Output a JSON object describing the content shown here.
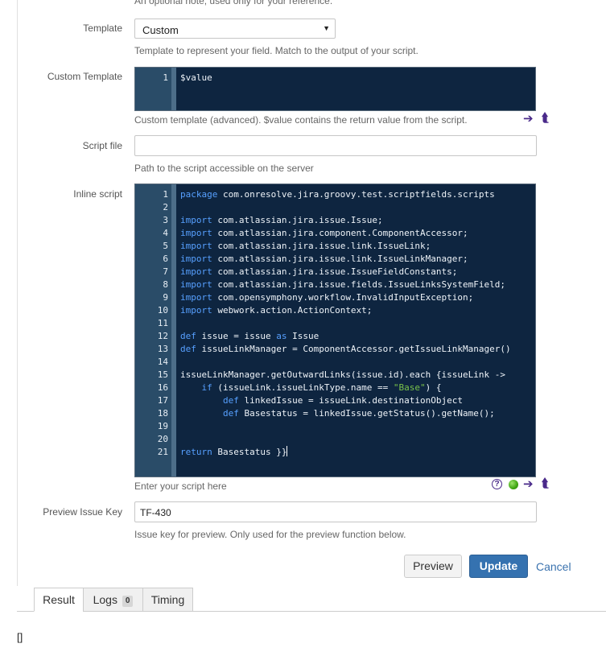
{
  "top_help": "An optional note, used only for your reference.",
  "template": {
    "label": "Template",
    "value": "Custom",
    "help": "Template to represent your field. Match to the output of your script."
  },
  "custom_template": {
    "label": "Custom Template",
    "lines": [
      {
        "n": "1",
        "text": "$value"
      }
    ],
    "help": "Custom template (advanced). $value contains the return value from the script."
  },
  "script_file": {
    "label": "Script file",
    "value": "",
    "help": "Path to the script accessible on the server"
  },
  "inline_script": {
    "label": "Inline script",
    "help": "Enter your script here",
    "lines": [
      {
        "n": "1",
        "parts": [
          {
            "t": "package",
            "c": "kw"
          },
          {
            "t": " com.onresolve.jira.groovy.test.scriptfields.scripts"
          }
        ]
      },
      {
        "n": "2",
        "parts": []
      },
      {
        "n": "3",
        "parts": [
          {
            "t": "import",
            "c": "kw"
          },
          {
            "t": " com.atlassian.jira.issue.Issue;"
          }
        ]
      },
      {
        "n": "4",
        "parts": [
          {
            "t": "import",
            "c": "kw"
          },
          {
            "t": " com.atlassian.jira.component.ComponentAccessor;"
          }
        ]
      },
      {
        "n": "5",
        "parts": [
          {
            "t": "import",
            "c": "kw"
          },
          {
            "t": " com.atlassian.jira.issue.link.IssueLink;"
          }
        ]
      },
      {
        "n": "6",
        "parts": [
          {
            "t": "import",
            "c": "kw"
          },
          {
            "t": " com.atlassian.jira.issue.link.IssueLinkManager;"
          }
        ]
      },
      {
        "n": "7",
        "parts": [
          {
            "t": "import",
            "c": "kw"
          },
          {
            "t": " com.atlassian.jira.issue.IssueFieldConstants;"
          }
        ]
      },
      {
        "n": "8",
        "parts": [
          {
            "t": "import",
            "c": "kw"
          },
          {
            "t": " com.atlassian.jira.issue.fields.IssueLinksSystemField;"
          }
        ]
      },
      {
        "n": "9",
        "parts": [
          {
            "t": "import",
            "c": "kw"
          },
          {
            "t": " com.opensymphony.workflow.InvalidInputException;"
          }
        ]
      },
      {
        "n": "10",
        "parts": [
          {
            "t": "import",
            "c": "kw"
          },
          {
            "t": " webwork.action.ActionContext;"
          }
        ]
      },
      {
        "n": "11",
        "parts": []
      },
      {
        "n": "12",
        "parts": [
          {
            "t": "def",
            "c": "kw"
          },
          {
            "t": " issue = issue "
          },
          {
            "t": "as",
            "c": "kw"
          },
          {
            "t": " Issue"
          }
        ]
      },
      {
        "n": "13",
        "parts": [
          {
            "t": "def",
            "c": "kw"
          },
          {
            "t": " issueLinkManager = ComponentAccessor.getIssueLinkManager()"
          }
        ]
      },
      {
        "n": "14",
        "parts": []
      },
      {
        "n": "15",
        "parts": [
          {
            "t": "issueLinkManager.getOutwardLinks(issue.id).each {issueLink ->"
          }
        ]
      },
      {
        "n": "16",
        "parts": [
          {
            "t": "    "
          },
          {
            "t": "if",
            "c": "kw"
          },
          {
            "t": " (issueLink.issueLinkType.name == "
          },
          {
            "t": "\"Base\"",
            "c": "str"
          },
          {
            "t": ") {"
          }
        ]
      },
      {
        "n": "17",
        "parts": [
          {
            "t": "        "
          },
          {
            "t": "def",
            "c": "kw"
          },
          {
            "t": " linkedIssue = issueLink.destinationObject"
          }
        ]
      },
      {
        "n": "18",
        "parts": [
          {
            "t": "        "
          },
          {
            "t": "def",
            "c": "kw"
          },
          {
            "t": " Basestatus = linkedIssue.getStatus().getName();"
          }
        ]
      },
      {
        "n": "19",
        "parts": []
      },
      {
        "n": "20",
        "parts": []
      },
      {
        "n": "21",
        "parts": [
          {
            "t": "return",
            "c": "kw"
          },
          {
            "t": " Basestatus }}"
          }
        ],
        "cursor": true
      }
    ]
  },
  "preview_issue_key": {
    "label": "Preview Issue Key",
    "value": "TF-430",
    "help": "Issue key for preview. Only used for the preview function below."
  },
  "buttons": {
    "preview": "Preview",
    "update": "Update",
    "cancel": "Cancel"
  },
  "tabs": {
    "result": "Result",
    "logs": "Logs",
    "logs_count": "0",
    "timing": "Timing"
  },
  "result_text": "[]",
  "icons": {
    "expand": "arrow-right-icon",
    "collapse": "arrow-up-left-icon",
    "help": "help-circle-icon",
    "status": "green-status-dot-icon"
  }
}
